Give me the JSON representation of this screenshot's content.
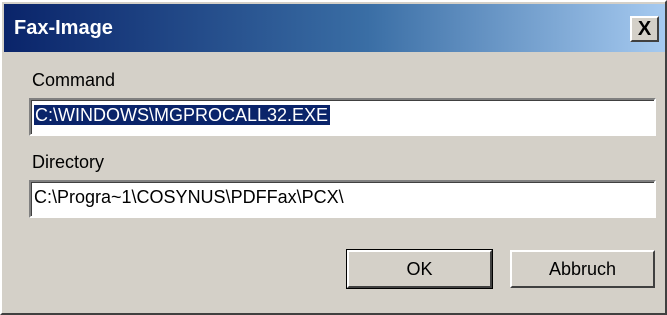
{
  "window": {
    "title": "Fax-Image",
    "close_label": "X"
  },
  "command": {
    "label": "Command",
    "value": "C:\\WINDOWS\\MGPROCALL32.EXE"
  },
  "directory": {
    "label": "Directory",
    "value": "C:\\Progra~1\\COSYNUS\\PDFFax\\PCX\\"
  },
  "buttons": {
    "ok_label": "OK",
    "cancel_label": "Abbruch"
  },
  "colors": {
    "title_bar_start": "#0a246a",
    "title_bar_end": "#a6caf0",
    "dialog_face": "#d4d0c8",
    "selection": "#0a246a"
  }
}
